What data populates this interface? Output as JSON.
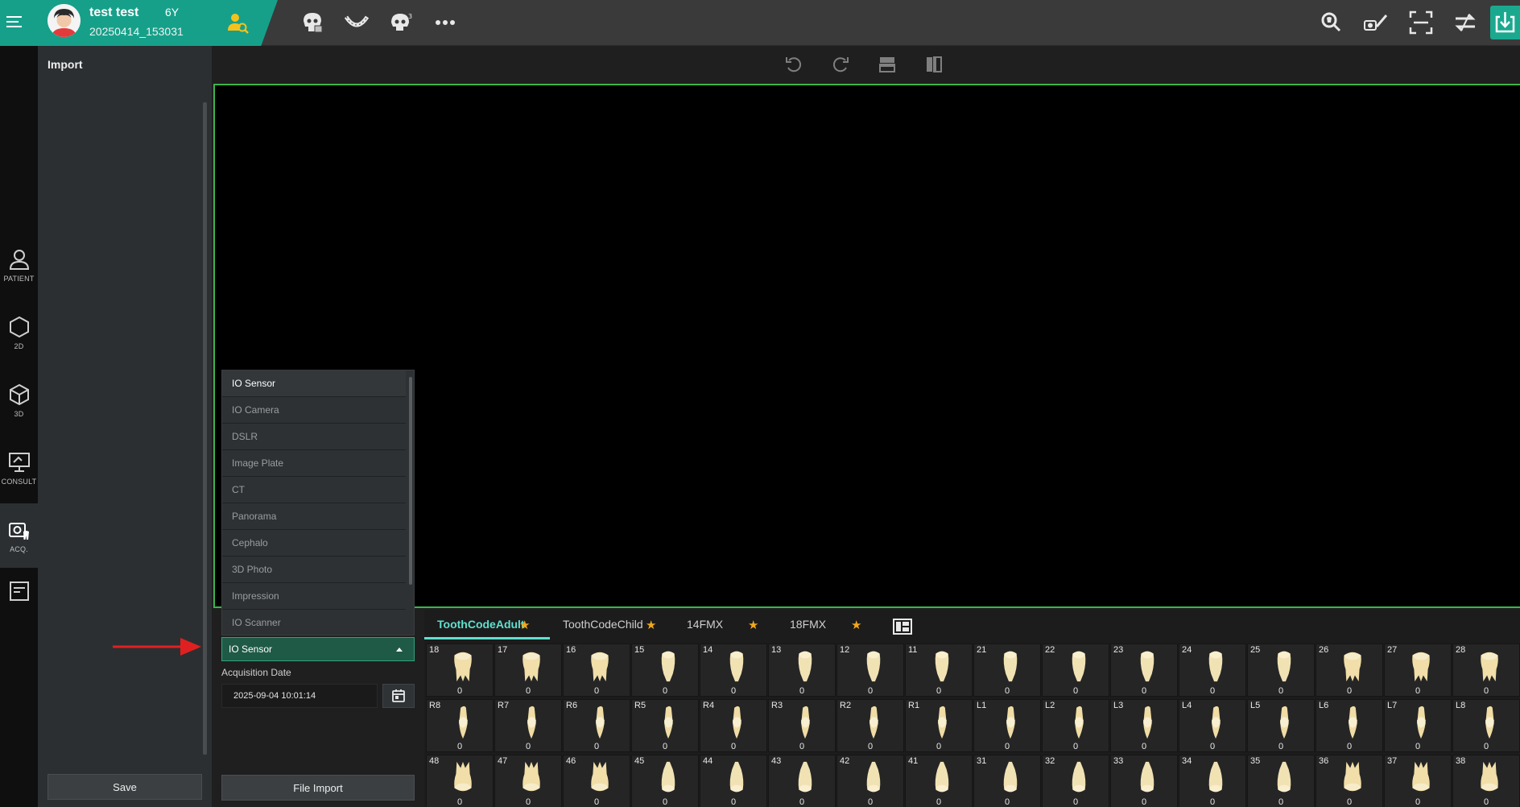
{
  "patient": {
    "name": "test test",
    "age": "6Y",
    "id": "20250414_153031"
  },
  "sidebar": {
    "title": "Import",
    "save_label": "Save"
  },
  "nav": [
    {
      "label": "PATIENT",
      "icon": "patient-icon"
    },
    {
      "label": "2D",
      "icon": "hexagon-2d-icon"
    },
    {
      "label": "3D",
      "icon": "cube-3d-icon"
    },
    {
      "label": "CONSULT",
      "icon": "consult-icon"
    },
    {
      "label": "ACQ.",
      "icon": "acquisition-icon"
    },
    {
      "label": "",
      "icon": "report-icon"
    }
  ],
  "modality": {
    "selected": "IO Sensor",
    "options": [
      "IO Sensor",
      "IO Camera",
      "DSLR",
      "Image Plate",
      "CT",
      "Panorama",
      "Cephalo",
      "3D Photo",
      "Impression",
      "IO Scanner"
    ]
  },
  "acquisition": {
    "label": "Acquisition Date",
    "date": "2025-09-04 10:01:14"
  },
  "file_import_label": "File Import",
  "tabs": [
    "ToothCodeAdult",
    "ToothCodeChild",
    "14FMX",
    "18FMX"
  ],
  "tooth_rows": [
    {
      "codes": [
        "18",
        "17",
        "16",
        "15",
        "14",
        "13",
        "12",
        "11",
        "21",
        "22",
        "23",
        "24",
        "25",
        "26",
        "27",
        "28"
      ],
      "counts": [
        "0",
        "0",
        "0",
        "0",
        "0",
        "0",
        "0",
        "0",
        "0",
        "0",
        "0",
        "0",
        "0",
        "0",
        "0",
        "0"
      ]
    },
    {
      "codes": [
        "R8",
        "R7",
        "R6",
        "R5",
        "R4",
        "R3",
        "R2",
        "R1",
        "L1",
        "L2",
        "L3",
        "L4",
        "L5",
        "L6",
        "L7",
        "L8"
      ],
      "counts": [
        "0",
        "0",
        "0",
        "0",
        "0",
        "0",
        "0",
        "0",
        "0",
        "0",
        "0",
        "0",
        "0",
        "0",
        "0",
        "0"
      ]
    },
    {
      "codes": [
        "48",
        "47",
        "46",
        "45",
        "44",
        "43",
        "42",
        "41",
        "31",
        "32",
        "33",
        "34",
        "35",
        "36",
        "37",
        "38"
      ],
      "counts": [
        "0",
        "0",
        "0",
        "0",
        "0",
        "0",
        "0",
        "0",
        "0",
        "0",
        "0",
        "0",
        "0",
        "0",
        "0",
        "0"
      ]
    }
  ],
  "colors": {
    "accent": "#16a08a",
    "tab_active": "#5fe0cf",
    "viewport_border": "#3bb54a",
    "star": "#f2a81d",
    "arrow": "#e02020"
  }
}
